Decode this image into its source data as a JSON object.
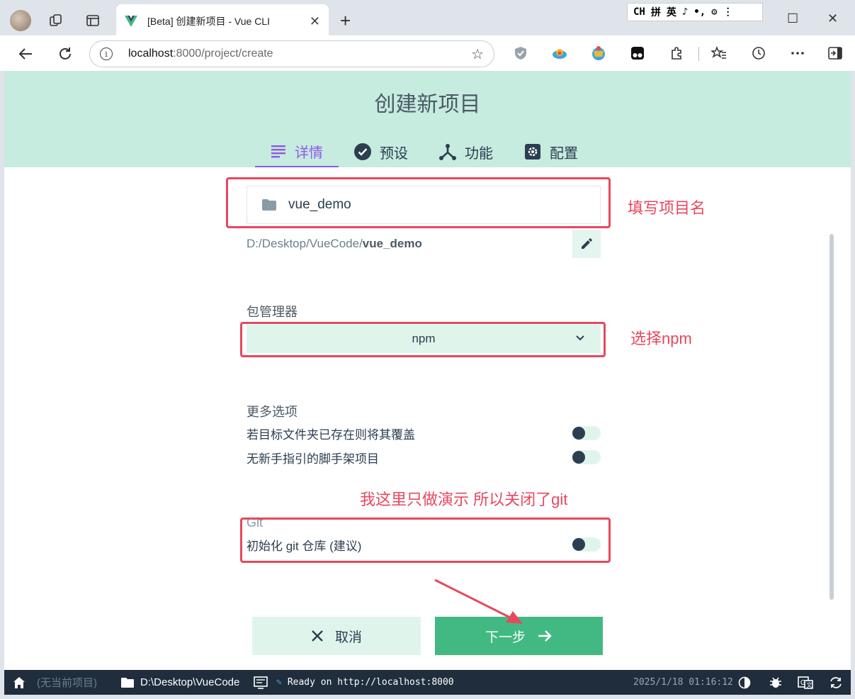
{
  "browser": {
    "tab_title": "[Beta] 创建新项目 - Vue CLI",
    "tab_close": "✕",
    "new_tab": "+",
    "url_host": "localhost",
    "url_path": ":8000/project/create",
    "ime": [
      "CH",
      "拼",
      "英",
      "♪",
      "•,",
      "⚙",
      "⋮"
    ],
    "win_min": "—",
    "win_max": "☐",
    "win_close": "✕",
    "info_glyph": "i",
    "star_glyph": "☆"
  },
  "page": {
    "title": "创建新项目",
    "steps": [
      {
        "label": "详情",
        "icon": "list-icon",
        "active": true
      },
      {
        "label": "预设",
        "icon": "check-circle-icon",
        "active": false
      },
      {
        "label": "功能",
        "icon": "fork-icon",
        "active": false
      },
      {
        "label": "配置",
        "icon": "settings-icon",
        "active": false
      }
    ],
    "project_name": "vue_demo",
    "path_prefix": "D:/Desktop/VueCode/",
    "path_name": "vue_demo",
    "package_manager_label": "包管理器",
    "package_manager_value": "npm",
    "more_options_label": "更多选项",
    "option_overwrite": "若目标文件夹已存在则将其覆盖",
    "option_no_guide": "无新手指引的脚手架项目",
    "git_label": "Git",
    "git_init": "初始化 git 仓库 (建议)",
    "cancel_label": "取消",
    "next_label": "下一步"
  },
  "annotations": {
    "name_hint": "填写项目名",
    "npm_hint": "选择npm",
    "git_hint": "我这里只做演示 所以关闭了git",
    "color": "#e8475d"
  },
  "statusbar": {
    "no_project": "(无当前项目)",
    "folder": "D:\\Desktop\\VueCode",
    "log": "Ready on http://localhost:8000",
    "datetime": "2025/1/18 01:16:12"
  },
  "colors": {
    "accent": "#42b983",
    "header_bg": "#c6ebdf",
    "active_step": "#8f59e8",
    "statusbar_bg": "#1f2d3d"
  }
}
